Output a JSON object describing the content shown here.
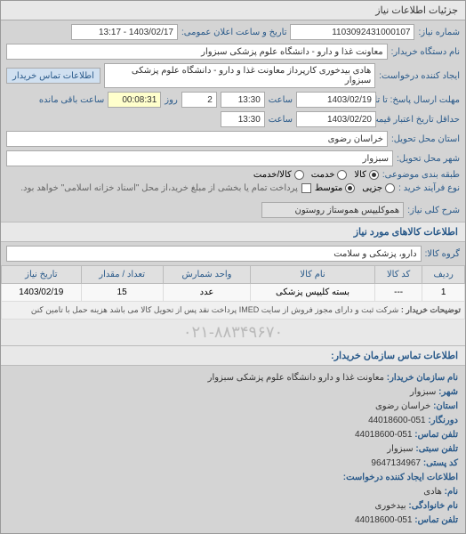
{
  "title": "جزئیات اطلاعات نیاز",
  "header": {
    "request_no_label": "شماره نیاز:",
    "request_no": "1103092431000107",
    "announce_label": "تاریخ و ساعت اعلان عمومی:",
    "announce_value": "1403/02/17 - 13:17",
    "org_label": "نام دستگاه خریدار:",
    "org_value": "معاونت غذا و دارو - دانشگاه علوم پزشکی سبزوار",
    "creator_label": "ایجاد کننده درخواست:",
    "creator_value": "هادی بیدخوری کارپرداز معاونت غذا و دارو - دانشگاه علوم پزشکی سبزوار",
    "contact_btn": "اطلاعات تماس خریدار"
  },
  "deadline": {
    "response_label": "مهلت ارسال پاسخ: تا تاریخ:",
    "response_date": "1403/02/19",
    "time_label": "ساعت",
    "response_time": "13:30",
    "days_field": "2",
    "days_label": "روز",
    "remaining": "00:08:31",
    "remaining_label": "ساعت باقی مانده",
    "valid_label": "حداقل تاریخ اعتبار قیمت: تا تاریخ:",
    "valid_date": "1403/02/20",
    "valid_time": "13:30"
  },
  "location": {
    "province_label": "استان محل تحویل:",
    "province": "خراسان رضوی",
    "city_label": "شهر محل تحویل:",
    "city": "سبزوار"
  },
  "category": {
    "label": "طبقه بندی موضوعی:",
    "opt_goods": "کالا",
    "opt_service": "خدمت",
    "opt_both": "کالا/خدمت"
  },
  "process": {
    "label": "نوع فرآیند خرید :",
    "opt_small": "جزیی",
    "opt_medium": "متوسط",
    "note": "پرداخت تمام یا بخشی از مبلغ خرید،از محل \"اسناد خزانه اسلامی\" خواهد بود."
  },
  "summary": {
    "label": "شرح کلی نیاز:",
    "value": "هموکلیپس هموستاز روستون"
  },
  "items_header": "اطلاعات کالاهای مورد نیاز",
  "group": {
    "label": "گروه کالا:",
    "value": "دارو، پزشکی و سلامت"
  },
  "table": {
    "cols": [
      "ردیف",
      "کد کالا",
      "نام کالا",
      "واحد شمارش",
      "تعداد / مقدار",
      "تاریخ نیاز"
    ],
    "rows": [
      {
        "idx": "1",
        "code": "---",
        "name": "بسته کلیپس پزشکی",
        "unit": "عدد",
        "qty": "15",
        "date": "1403/02/19"
      }
    ],
    "note_label": "توضیحات خریدار :",
    "note_text": "شرکت ثبت و دارای مجوز فروش از سایت IMED پرداخت نقد پس از تحویل کالا می باشد هزینه حمل با تامین کنن"
  },
  "watermark": "۰۲۱-۸۸۳۴۹۶۷۰",
  "contact": {
    "header": "اطلاعات تماس سازمان خریدار:",
    "org_label": "نام سازمان خریدار:",
    "org": "معاونت غذا و دارو دانشگاه علوم پزشکی سبزوار",
    "city_label": "شهر:",
    "city": "سبزوار",
    "province_label": "استان:",
    "province": "خراسان رضوی",
    "switch_label": "دورنگار:",
    "switch": "051-44018600",
    "phone_label": "تلفن تماس:",
    "phone": "051-44018600",
    "post_label": "تلفن سبتی:",
    "post": "سبزوار",
    "postcode_label": "کد پستی:",
    "postcode": "9647134967",
    "creator_header": "اطلاعات ایجاد کننده درخواست:",
    "fname_label": "نام:",
    "fname": "هادی",
    "lname_label": "نام خانوادگی:",
    "lname": "بیدخوری",
    "cphone_label": "تلفن تماس:",
    "cphone": "051-44018600"
  }
}
